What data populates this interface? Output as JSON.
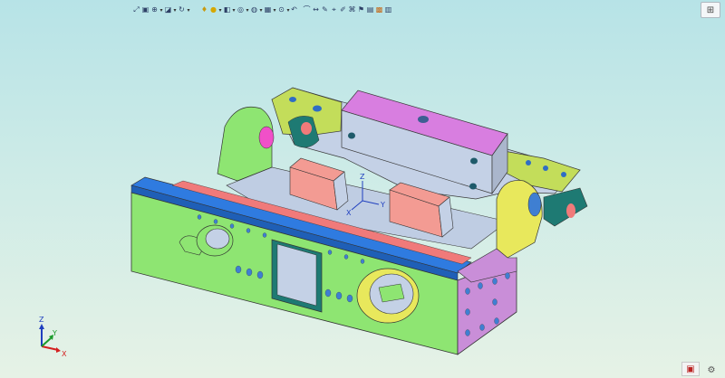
{
  "toolbars": {
    "view_group": [
      "zoom-all-icon",
      "zoom-window-icon",
      "zoom-icon",
      "view-cube-icon"
    ],
    "display_group": [
      "light-icon",
      "bulb-icon",
      "section-icon",
      "hide-icon",
      "render-icon",
      "camera-icon",
      "magnify-icon"
    ],
    "tools_group": [
      "undo-icon",
      "measure-icon",
      "dimension-icon",
      "annotate-icon",
      "markup-icon",
      "note-icon",
      "stamp-icon",
      "palette-icon",
      "settings-icon"
    ]
  },
  "triad": {
    "x_label": "X",
    "y_label": "Y",
    "z_label": "Z"
  },
  "origin_triad": {
    "x_label": "X",
    "y_label": "Y",
    "z_label": "Z"
  },
  "colors": {
    "body": "#8ee572",
    "plate": "#c4d1e6",
    "top_bar": "#d87ee0",
    "rail": "#2f7be0",
    "rail_red": "#f07a7a",
    "block": "#f39b93",
    "yellow": "#e8e85c",
    "teal": "#1e7a73",
    "hole": "#3f7fd2",
    "pink_hole": "#f050c8"
  }
}
